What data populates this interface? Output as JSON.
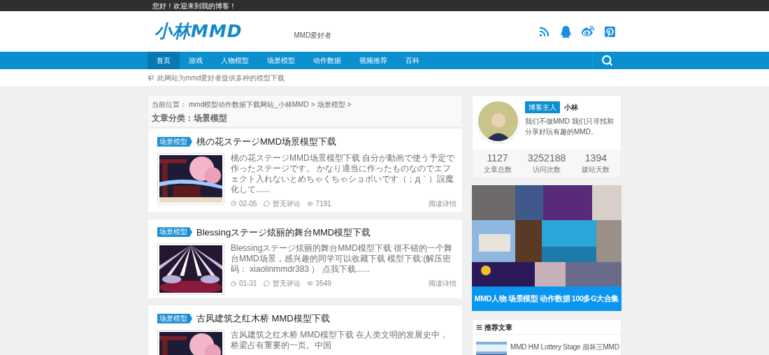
{
  "top_bar": {
    "greeting": "您好！欢迎来到我的博客！"
  },
  "header": {
    "logo": "小林MMD",
    "tagline": "MMD爱好者"
  },
  "nav": {
    "items": [
      {
        "label": "首页",
        "selected": true
      },
      {
        "label": "游戏",
        "selected": false
      },
      {
        "label": "人物模型",
        "selected": false
      },
      {
        "label": "场景模型",
        "selected": false
      },
      {
        "label": "动作数据",
        "selected": false
      },
      {
        "label": "视频推荐",
        "selected": false
      },
      {
        "label": "百科",
        "selected": false
      }
    ]
  },
  "notice": "此网站为mmd爱好者提供多种的模型下载",
  "breadcrumb": {
    "prefix": "当前位置：",
    "links": [
      "mmd模型动作数据下载网站_小林MMD",
      "场景模型"
    ],
    "separator": ">"
  },
  "category_title": "文章分类：场景模型",
  "posts": [
    {
      "tag": "场景模型",
      "title": "桃の花ステージMMD场景模型下载",
      "excerpt": "桃の花ステージMMD场景模型下载 自分が動画で使う予定で作ったステージです。 かなり適当に作ったものなのでエフェクト入れないとめちゃくちゃショボいです（；д｀）誤魔化して......",
      "date": "02-05",
      "comments": "暂无评论",
      "views": "7191",
      "read_more": "阅读详情"
    },
    {
      "tag": "场景模型",
      "title": "Blessingステージ炫丽的舞台MMD模型下载",
      "excerpt": "Blessingステージ炫丽的舞台MMD模型下载 很不错的一个舞台MMD场景，感兴趣的同学可以收藏下载 模型下载:(解压密码： xiaolinmmdr383 ） 点我下载......",
      "date": "01-31",
      "comments": "暂无评论",
      "views": "3549",
      "read_more": "阅读详情"
    },
    {
      "tag": "场景模型",
      "title": "古风建筑之红木桥 MMD模型下载",
      "excerpt": "古风建筑之红木桥 MMD模型下载 在人类文明的发展史中，桥梁占有重要的一页。中国"
    }
  ],
  "profile": {
    "badge": "博客主人",
    "name": "小林",
    "bio": "我们不做MMD 我们只寻找和分享好玩有趣的MMD。",
    "stats": [
      {
        "value": "1127",
        "label": "文章总数"
      },
      {
        "value": "3252188",
        "label": "访问次数"
      },
      {
        "value": "1394",
        "label": "建站天数"
      }
    ]
  },
  "banner": {
    "caption": "MMD人物 场景模型 动作数据 100多G大合集"
  },
  "recommended": {
    "title": "推荐文章",
    "items": [
      {
        "title": "MMD HM Lottery Stage 崩坏三MMD"
      }
    ]
  }
}
